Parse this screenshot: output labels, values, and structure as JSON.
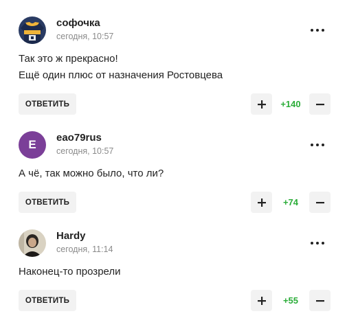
{
  "comments": [
    {
      "author": "софочка",
      "time": "сегодня, 10:57",
      "lines": [
        "Так это ж прекрасно!",
        "Ещё один плюс от назначения Ростовцева"
      ],
      "reply_label": "ОТВЕТИТЬ",
      "score": "+140",
      "avatar": {
        "type": "image",
        "desc": "jersey-avatar",
        "bg": "#2a3b63",
        "accent": "#f0b43a"
      }
    },
    {
      "author": "eao79rus",
      "time": "сегодня, 10:57",
      "lines": [
        "А чё, так можно было, что ли?"
      ],
      "reply_label": "ОТВЕТИТЬ",
      "score": "+74",
      "avatar": {
        "type": "letter",
        "letter": "E",
        "bg": "#7b3f98"
      }
    },
    {
      "author": "Hardy",
      "time": "сегодня, 11:14",
      "lines": [
        "Наконец-то прозрели"
      ],
      "reply_label": "ОТВЕТИТЬ",
      "score": "+55",
      "avatar": {
        "type": "image",
        "desc": "person-photo-avatar",
        "bg": "#d9d2c2",
        "accent": "#2b2622"
      }
    }
  ],
  "colors": {
    "score_positive": "#2bad39",
    "button_bg": "#f2f2f2",
    "meta_text": "#8a8a8a"
  }
}
